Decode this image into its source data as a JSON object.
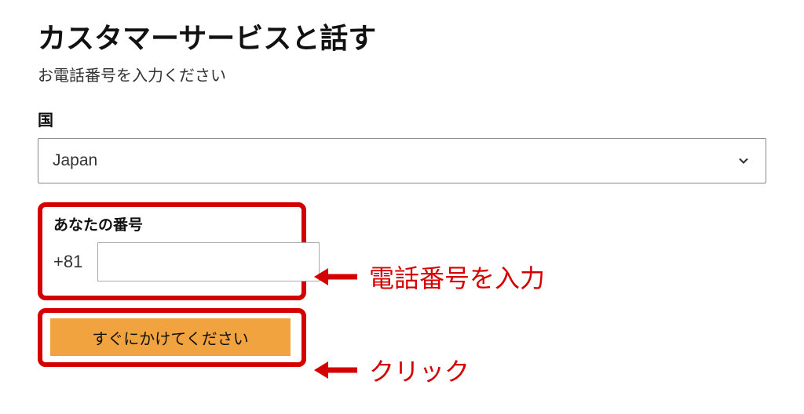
{
  "page": {
    "title": "カスタマーサービスと話す",
    "subtitle": "お電話番号を入力ください"
  },
  "country": {
    "label": "国",
    "selected": "Japan"
  },
  "phone": {
    "label": "あなたの番号",
    "prefix": "+81",
    "value": ""
  },
  "call": {
    "button_label": "すぐにかけてください"
  },
  "annotations": {
    "phone_help": "電話番号を入力",
    "click_help": "クリック"
  },
  "colors": {
    "highlight": "#d40000",
    "accent": "#f0a33f"
  }
}
